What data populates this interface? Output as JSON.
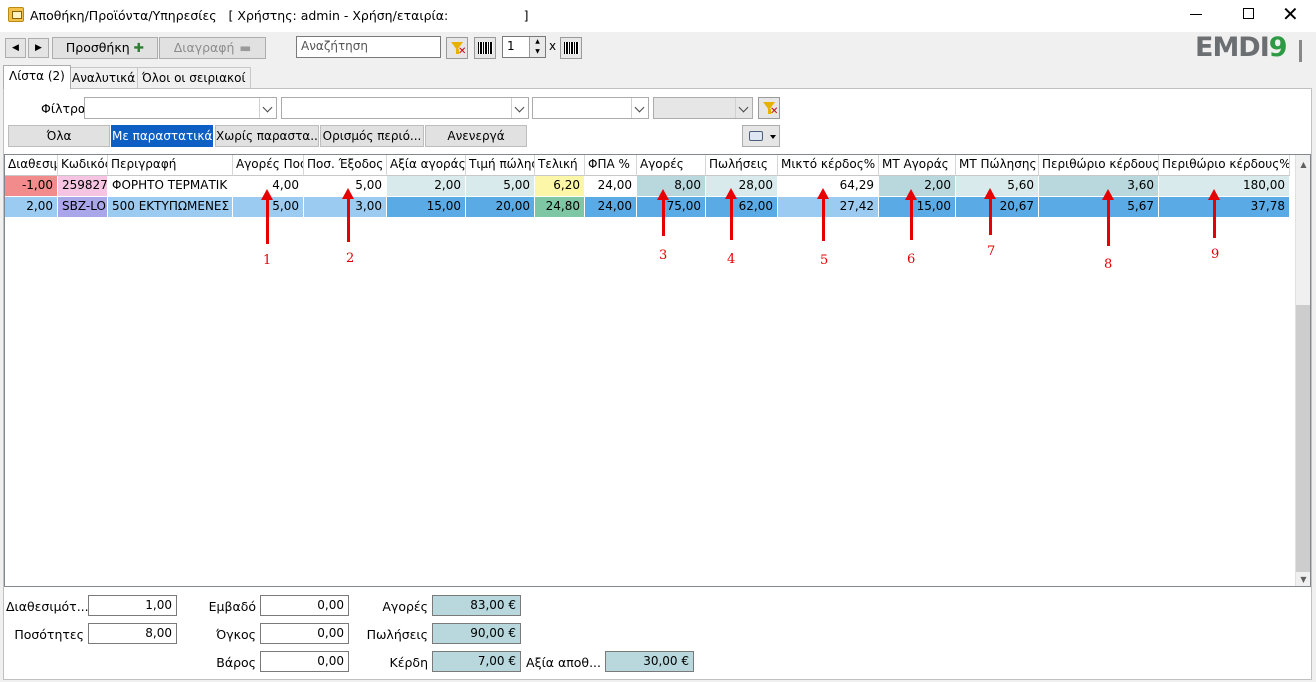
{
  "window": {
    "title": "Αποθήκη/Προϊόντα/Υπηρεσίες   [ Χρήστης: admin - Χρήση/εταιρία:                   ]"
  },
  "toolbar": {
    "add_label": "Προσθήκη",
    "delete_label": "Διαγραφή",
    "search_placeholder": "Αναζήτηση",
    "quantity": "1",
    "times": "x"
  },
  "logo": {
    "text": "EMDI",
    "digit": "9"
  },
  "tabs": [
    {
      "label": "Λίστα (2)"
    },
    {
      "label": "Αναλυτικά"
    },
    {
      "label": "Όλοι οι σειριακοί"
    }
  ],
  "filters": {
    "label": "Φίλτρα"
  },
  "quick_filters": [
    {
      "label": "Όλα"
    },
    {
      "label": "Με παραστατικά"
    },
    {
      "label": "Χωρίς παραστα..."
    },
    {
      "label": "Ορισμός περιό..."
    },
    {
      "label": "Ανενεργά"
    }
  ],
  "grid": {
    "columns": [
      "Διαθεσιμ",
      "Κωδικός",
      "Περιγραφή",
      "Αγορές Ποσ",
      "Ποσ. Έξοδος",
      "Αξία αγοράς",
      "Τιμή πώλησ",
      "Τελική",
      "ΦΠΑ %",
      "Αγορές",
      "Πωλήσεις",
      "Μικτό κέρδος%",
      "ΜΤ Αγοράς",
      "ΜΤ Πώλησης",
      "Περιθώριο κέρδους",
      "Περιθώριο κέρδους%"
    ],
    "rows": [
      [
        "-1,00",
        "259827",
        "ΦΟΡΗΤΟ ΤΕΡΜΑΤΙΚ",
        "4,00",
        "5,00",
        "2,00",
        "5,00",
        "6,20",
        "24,00",
        "8,00",
        "28,00",
        "64,29",
        "2,00",
        "5,60",
        "3,60",
        "180,00"
      ],
      [
        "2,00",
        "SBZ-LO",
        "500 ΕΚΤΥΠΩΜΕΝΕΣ",
        "5,00",
        "3,00",
        "15,00",
        "20,00",
        "24,80",
        "24,00",
        "75,00",
        "62,00",
        "27,42",
        "15,00",
        "20,67",
        "5,67",
        "37,78"
      ]
    ]
  },
  "annotations": [
    "1",
    "2",
    "3",
    "4",
    "5",
    "6",
    "7",
    "8",
    "9"
  ],
  "footer": {
    "available_label": "Διαθεσιμότ...",
    "available_value": "1,00",
    "quantities_label": "Ποσότητες",
    "quantities_value": "8,00",
    "area_label": "Εμβαδό",
    "area_value": "0,00",
    "volume_label": "Όγκος",
    "volume_value": "0,00",
    "weight_label": "Βάρος",
    "weight_value": "0,00",
    "purchases_label": "Αγορές",
    "purchases_value": "83,00 €",
    "sales_label": "Πωλήσεις",
    "sales_value": "90,00 €",
    "profit_label": "Κέρδη",
    "profit_value": "7,00 €",
    "stock_value_label": "Αξία αποθ...",
    "stock_value_value": "30,00 €"
  },
  "colors": {
    "accent_blue": "#0d5fc4",
    "negative_stock": "#f28b8b",
    "code_pink": "#f4c4e2",
    "final_yellow": "#fbf6a8",
    "purchase_teal": "#b8d8dd",
    "selected_row": "#9ccbf1",
    "annotation_red": "#e60000",
    "logo_green": "#2f9a45"
  }
}
